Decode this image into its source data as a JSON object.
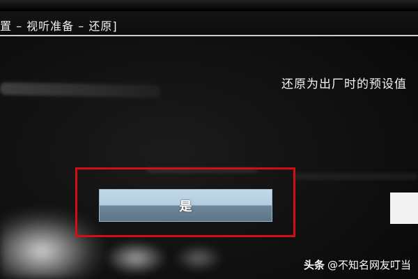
{
  "window": {
    "title": "置 – 视听准备 – 还原]"
  },
  "dialog": {
    "description": "还原为出厂时的预设值",
    "confirm_label": "是"
  },
  "watermark": {
    "brand": "头条",
    "author": "@不知名网友叮当"
  },
  "colors": {
    "highlight": "#d10f14",
    "button": "#b3cce0"
  }
}
